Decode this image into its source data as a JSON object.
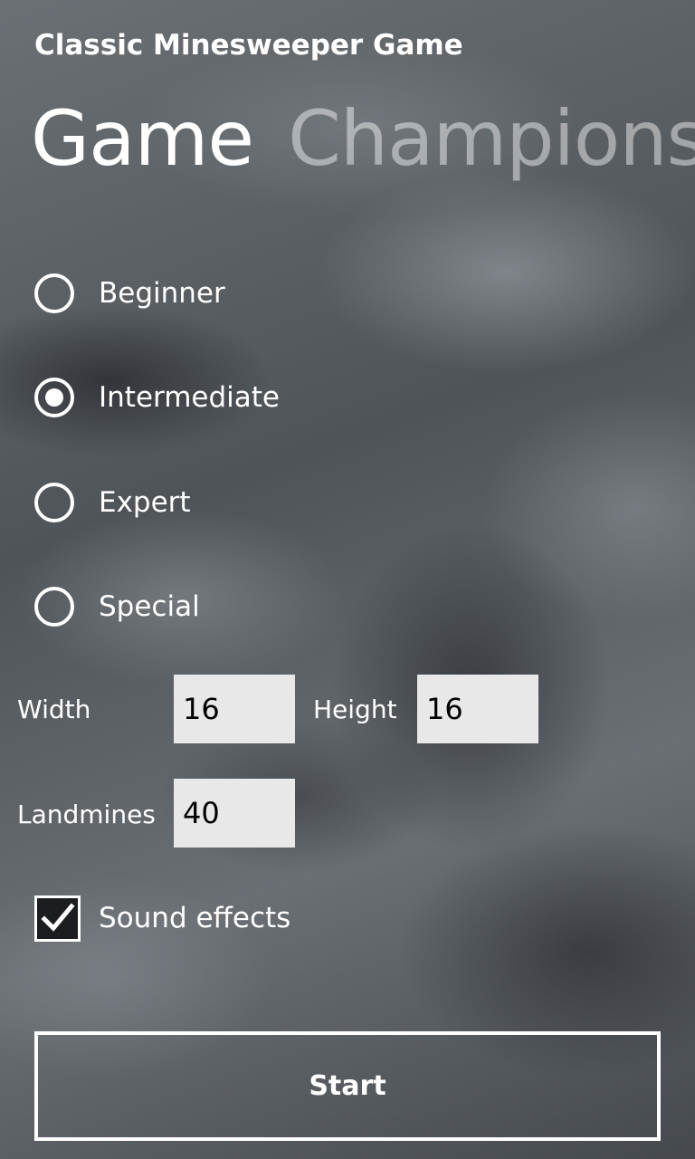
{
  "app": {
    "title": "Classic Minesweeper Game"
  },
  "pivot": {
    "headers": [
      {
        "label": "Game",
        "selected": true
      },
      {
        "label": "Champions",
        "selected": false
      }
    ]
  },
  "difficulty": {
    "options": [
      {
        "label": "Beginner",
        "checked": false
      },
      {
        "label": "Intermediate",
        "checked": true
      },
      {
        "label": "Expert",
        "checked": false
      },
      {
        "label": "Special",
        "checked": false
      }
    ]
  },
  "fields": {
    "width": {
      "label": "Width",
      "value": "16"
    },
    "height": {
      "label": "Height",
      "value": "16"
    },
    "landmines": {
      "label": "Landmines",
      "value": "40"
    }
  },
  "sound": {
    "label": "Sound effects",
    "checked": true
  },
  "start_button": {
    "label": "Start"
  },
  "icons": {
    "radio": "radio-button-icon",
    "checkmark": "checkmark-icon"
  },
  "colors": {
    "foreground": "#ffffff",
    "inactive_header": "rgba(255,255,255,0.45)",
    "textbox_bg": "#e8e8e8",
    "textbox_text": "#000000"
  }
}
